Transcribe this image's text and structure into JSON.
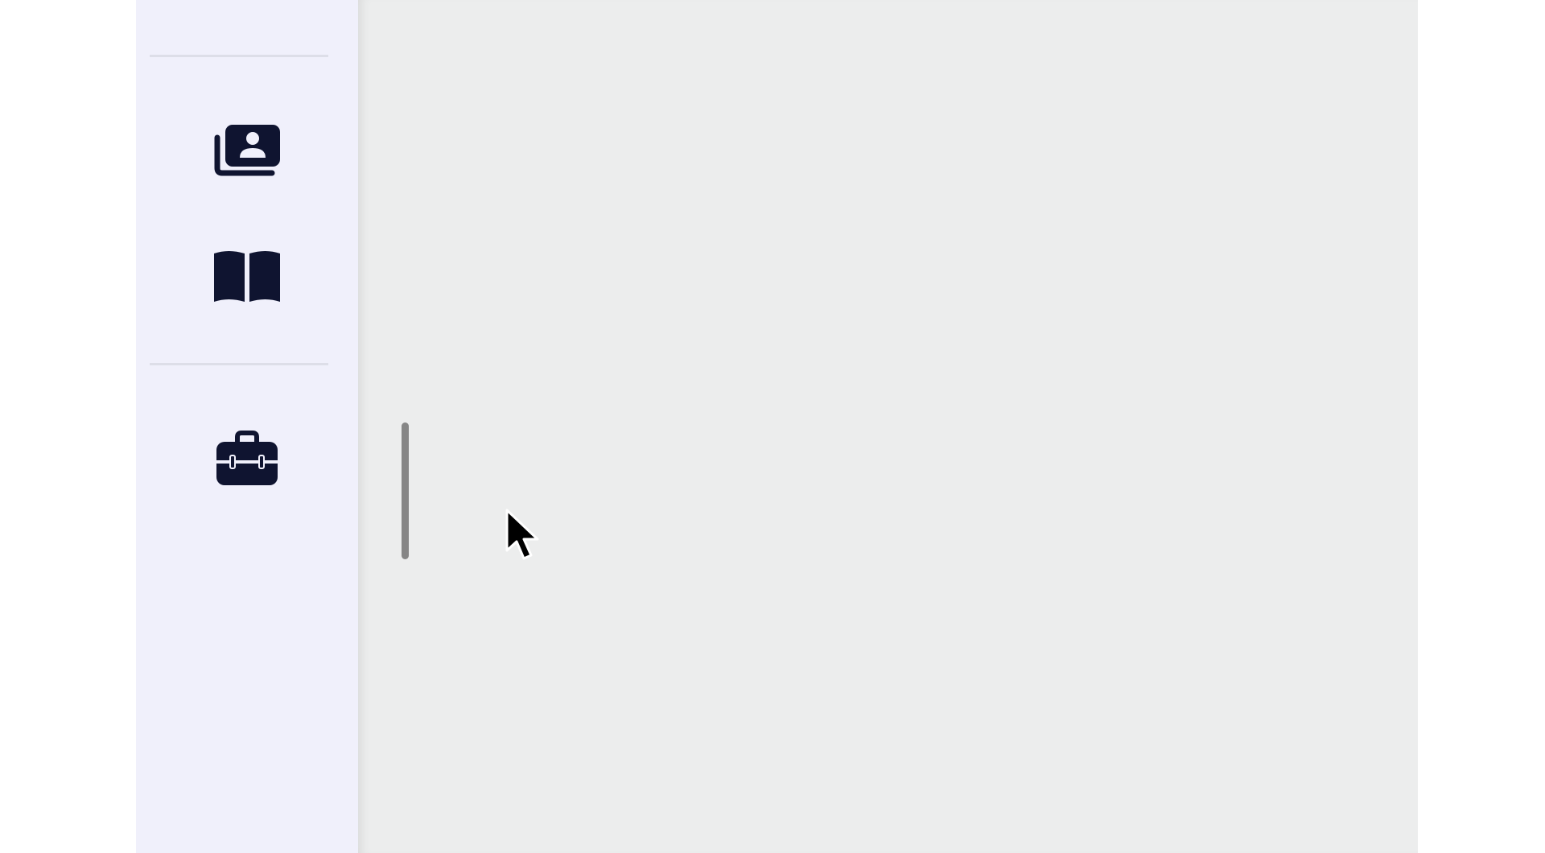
{
  "sidebar": {
    "background": "#f0f0fb",
    "icon_color": "#0f1430",
    "items": [
      {
        "id": "contacts",
        "icon": "contact-cards-icon"
      },
      {
        "id": "library",
        "icon": "open-book-icon"
      },
      {
        "id": "tools",
        "icon": "toolbox-icon"
      }
    ]
  },
  "content": {
    "background": "#eceded"
  },
  "pointer": {
    "icon": "mouse-pointer-icon"
  }
}
